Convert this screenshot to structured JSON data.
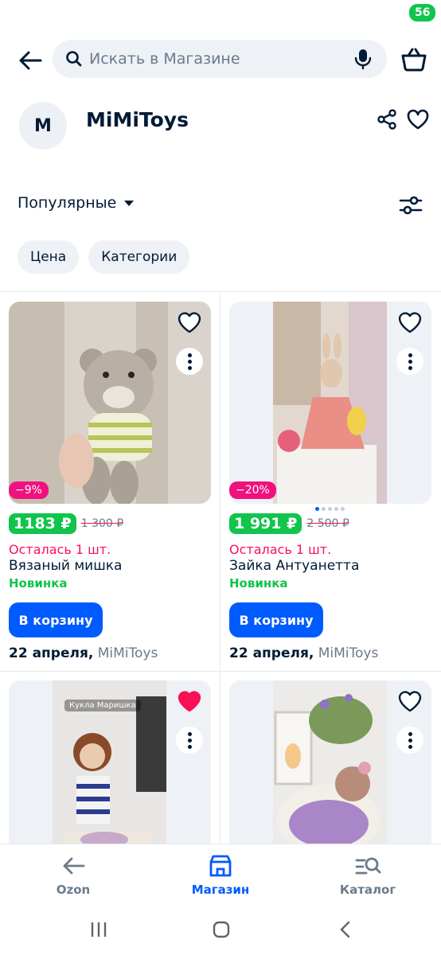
{
  "search": {
    "placeholder": "Искать в Магазине"
  },
  "cart": {
    "count": "56"
  },
  "store": {
    "initial": "M",
    "name": "MiMiToys"
  },
  "sort": {
    "label": "Популярные"
  },
  "chips": [
    "Цена",
    "Категории"
  ],
  "products": [
    {
      "discount": "−9%",
      "price": "1183 ₽",
      "old_price": "1 300 ₽",
      "stock": "Осталась 1 шт.",
      "title": "Вязаный мишка",
      "badge": "Новинка",
      "button": "В корзину",
      "delivery_date": "22 апреля,",
      "seller": "MiMiToys",
      "favorited": false
    },
    {
      "discount": "−20%",
      "price": "1 991 ₽",
      "old_price": "2 500 ₽",
      "stock": "Осталась 1 шт.",
      "title": "Зайка Антуанетта",
      "badge": "Новинка",
      "button": "В корзину",
      "delivery_date": "22 апреля,",
      "seller": "MiMiToys",
      "favorited": false
    },
    {
      "image_text": "Кукла Маришка",
      "favorited": true
    },
    {
      "favorited": false
    }
  ],
  "bottom_nav": [
    {
      "label": "Ozon",
      "icon": "arrow-left-icon",
      "active": false
    },
    {
      "label": "Магазин",
      "icon": "store-icon",
      "active": true
    },
    {
      "label": "Каталог",
      "icon": "catalog-search-icon",
      "active": false
    }
  ],
  "colors": {
    "accent": "#005bff",
    "price_green": "#10c44c",
    "discount_pink": "#f1117e",
    "stock_red": "#f91155"
  }
}
